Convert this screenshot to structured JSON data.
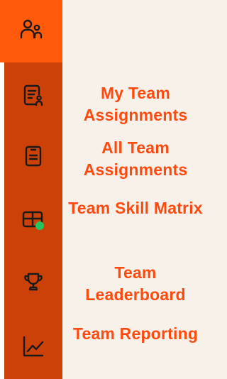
{
  "rail": {
    "top_icon": "team-people-icon",
    "icons": [
      "assignment-person-icon",
      "clipboard-list-icon",
      "grid-status-icon",
      "trophy-icon",
      "line-chart-icon"
    ],
    "status_dot_color": "#22c55e"
  },
  "menu": {
    "items": [
      {
        "label": "My Team Assignments"
      },
      {
        "label": "All Team Assignments"
      },
      {
        "label": "Team Skill Matrix"
      },
      {
        "label": "Team Leaderboard"
      },
      {
        "label": "Team Reporting"
      }
    ]
  },
  "colors": {
    "accent": "#ff5a0a",
    "rail_dark": "#cc4108",
    "label": "#ff4a0f",
    "background": "#f7f1ea"
  }
}
